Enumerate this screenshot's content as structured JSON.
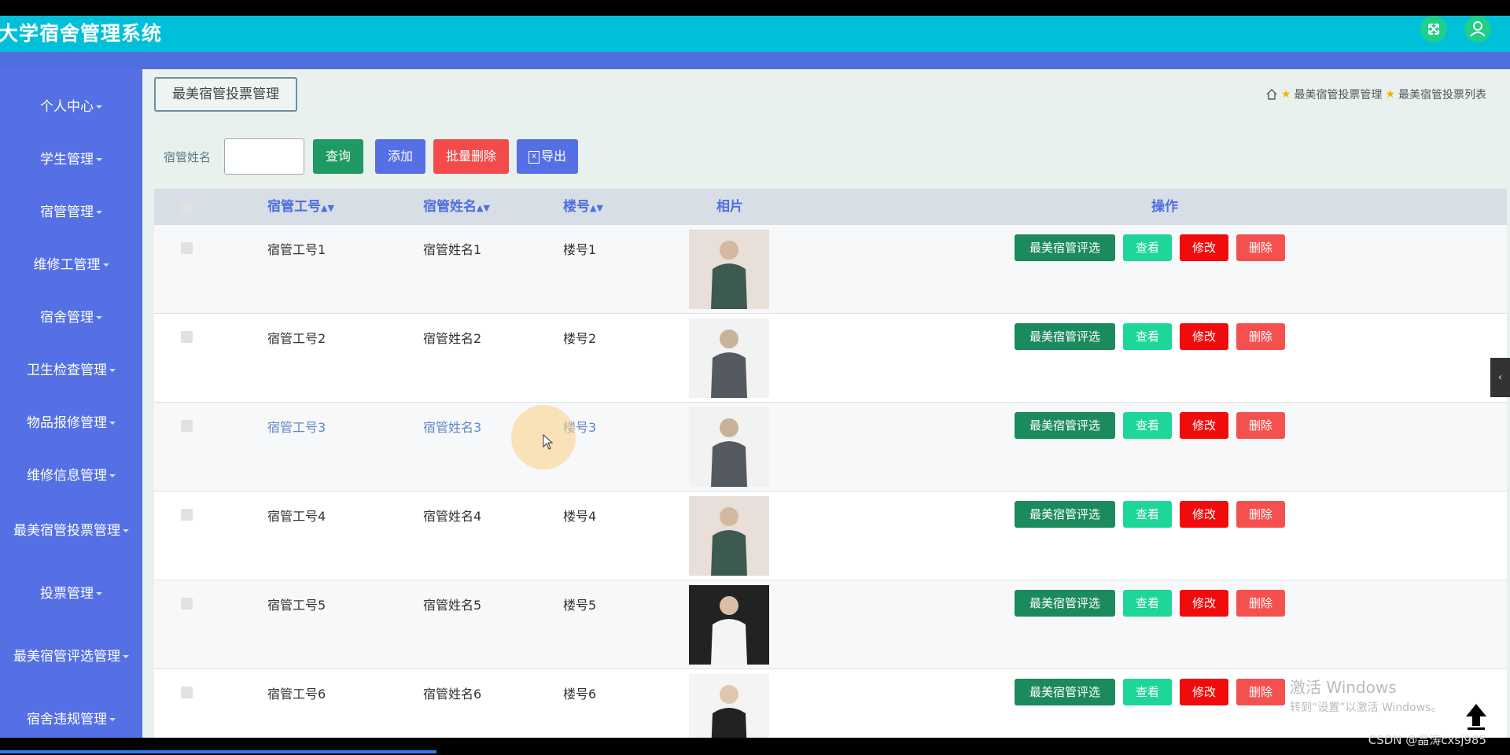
{
  "header": {
    "title": "大学宿舍管理系统"
  },
  "sidebar": {
    "items": [
      {
        "label": "个人中心"
      },
      {
        "label": "学生管理"
      },
      {
        "label": "宿管管理"
      },
      {
        "label": "维修工管理"
      },
      {
        "label": "宿舍管理"
      },
      {
        "label": "卫生检查管理"
      },
      {
        "label": "物品报修管理"
      },
      {
        "label": "维修信息管理"
      },
      {
        "label": "最美宿管投票管理"
      },
      {
        "label": "投票管理"
      },
      {
        "label": "最美宿管评选管理"
      },
      {
        "label": "宿舍违规管理"
      }
    ]
  },
  "page": {
    "title": "最美宿管投票管理"
  },
  "breadcrumb": {
    "item1": "最美宿管投票管理",
    "item2": "最美宿管投票列表"
  },
  "search": {
    "label": "宿管姓名",
    "value": ""
  },
  "toolbar": {
    "query": "查询",
    "add": "添加",
    "batch_delete": "批量删除",
    "export": "导出"
  },
  "table": {
    "headers": {
      "id": "宿管工号",
      "name": "宿管姓名",
      "building": "楼号",
      "photo": "相片",
      "actions": "操作"
    },
    "actions": {
      "select": "最美宿管评选",
      "view": "查看",
      "edit": "修改",
      "delete": "删除"
    },
    "rows": [
      {
        "id": "宿管工号1",
        "name": "宿管姓名1",
        "building": "楼号1"
      },
      {
        "id": "宿管工号2",
        "name": "宿管姓名2",
        "building": "楼号2"
      },
      {
        "id": "宿管工号3",
        "name": "宿管姓名3",
        "building": "楼号3"
      },
      {
        "id": "宿管工号4",
        "name": "宿管姓名4",
        "building": "楼号4"
      },
      {
        "id": "宿管工号5",
        "name": "宿管姓名5",
        "building": "楼号5"
      },
      {
        "id": "宿管工号6",
        "name": "宿管姓名6",
        "building": "楼号6"
      }
    ]
  },
  "watermark": {
    "line1": "激活 Windows",
    "line2": "转到“设置”以激活 Windows。"
  },
  "credit": "CSDN @晶涛cxsj985",
  "colors": {
    "header": "#00c0d9",
    "sidebar": "#5470e4",
    "query_btn": "#1f9a63",
    "add_btn": "#5470e4",
    "batch_delete_btn": "#f34a4a",
    "export_btn": "#5470e4",
    "select_btn": "#1b8a5c",
    "view_btn": "#1fd69a",
    "edit_btn": "#f00c0c",
    "delete_btn": "#f55050"
  }
}
